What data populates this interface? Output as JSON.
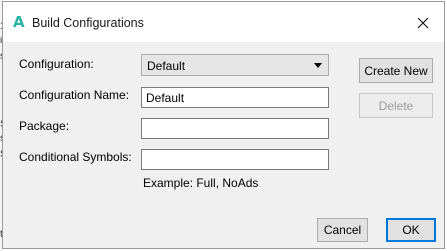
{
  "window": {
    "title": "Build Configurations",
    "app_icon_glyph": "A"
  },
  "form": {
    "configuration_label": "Configuration:",
    "configuration_value": "Default",
    "configuration_name_label": "Configuration Name:",
    "configuration_name_value": "Default",
    "package_label": "Package:",
    "package_value": "",
    "conditional_symbols_label": "Conditional Symbols:",
    "conditional_symbols_value": "",
    "example_text": "Example: Full, NoAds"
  },
  "side_buttons": {
    "create_new": "Create New",
    "delete": "Delete"
  },
  "footer_buttons": {
    "cancel": "Cancel",
    "ok": "OK"
  },
  "background_fragments": [
    "1",
    "i",
    "s",
    "S",
    "s",
    "S",
    "t"
  ],
  "colors": {
    "accent": "#0078d7",
    "app_icon": "#2bb5a3",
    "dialog_bg": "#f0f0f0"
  }
}
